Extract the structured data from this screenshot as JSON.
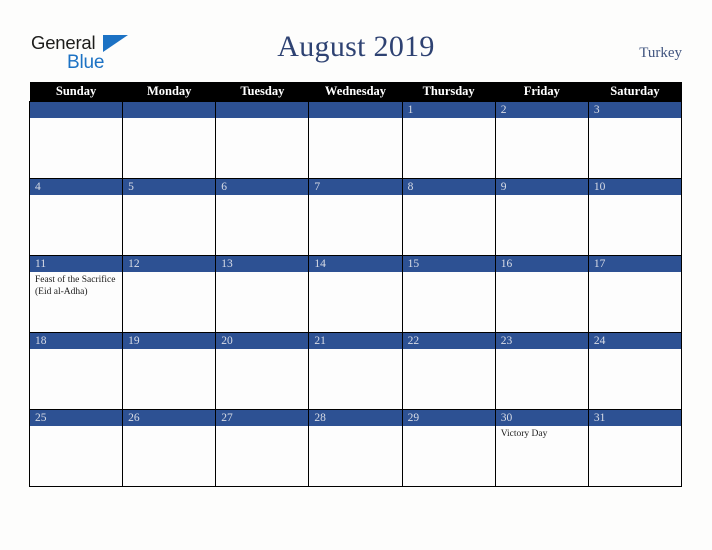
{
  "brand": {
    "name_part1": "General",
    "name_part2": "Blue",
    "triangle_color": "#1c72c4"
  },
  "header": {
    "title": "August 2019",
    "country": "Turkey",
    "title_color": "#2e4272"
  },
  "calendar": {
    "weekday_headers": [
      "Sunday",
      "Monday",
      "Tuesday",
      "Wednesday",
      "Thursday",
      "Friday",
      "Saturday"
    ],
    "header_bg": "#000000",
    "daybar_bg": "#2d5193",
    "daybar_text": "#d8dce6",
    "weeks": [
      [
        {
          "day": "",
          "event": ""
        },
        {
          "day": "",
          "event": ""
        },
        {
          "day": "",
          "event": ""
        },
        {
          "day": "",
          "event": ""
        },
        {
          "day": "1",
          "event": ""
        },
        {
          "day": "2",
          "event": ""
        },
        {
          "day": "3",
          "event": ""
        }
      ],
      [
        {
          "day": "4",
          "event": ""
        },
        {
          "day": "5",
          "event": ""
        },
        {
          "day": "6",
          "event": ""
        },
        {
          "day": "7",
          "event": ""
        },
        {
          "day": "8",
          "event": ""
        },
        {
          "day": "9",
          "event": ""
        },
        {
          "day": "10",
          "event": ""
        }
      ],
      [
        {
          "day": "11",
          "event": "Feast of the Sacrifice (Eid al-Adha)"
        },
        {
          "day": "12",
          "event": ""
        },
        {
          "day": "13",
          "event": ""
        },
        {
          "day": "14",
          "event": ""
        },
        {
          "day": "15",
          "event": ""
        },
        {
          "day": "16",
          "event": ""
        },
        {
          "day": "17",
          "event": ""
        }
      ],
      [
        {
          "day": "18",
          "event": ""
        },
        {
          "day": "19",
          "event": ""
        },
        {
          "day": "20",
          "event": ""
        },
        {
          "day": "21",
          "event": ""
        },
        {
          "day": "22",
          "event": ""
        },
        {
          "day": "23",
          "event": ""
        },
        {
          "day": "24",
          "event": ""
        }
      ],
      [
        {
          "day": "25",
          "event": ""
        },
        {
          "day": "26",
          "event": ""
        },
        {
          "day": "27",
          "event": ""
        },
        {
          "day": "28",
          "event": ""
        },
        {
          "day": "29",
          "event": ""
        },
        {
          "day": "30",
          "event": "Victory Day"
        },
        {
          "day": "31",
          "event": ""
        }
      ]
    ]
  }
}
